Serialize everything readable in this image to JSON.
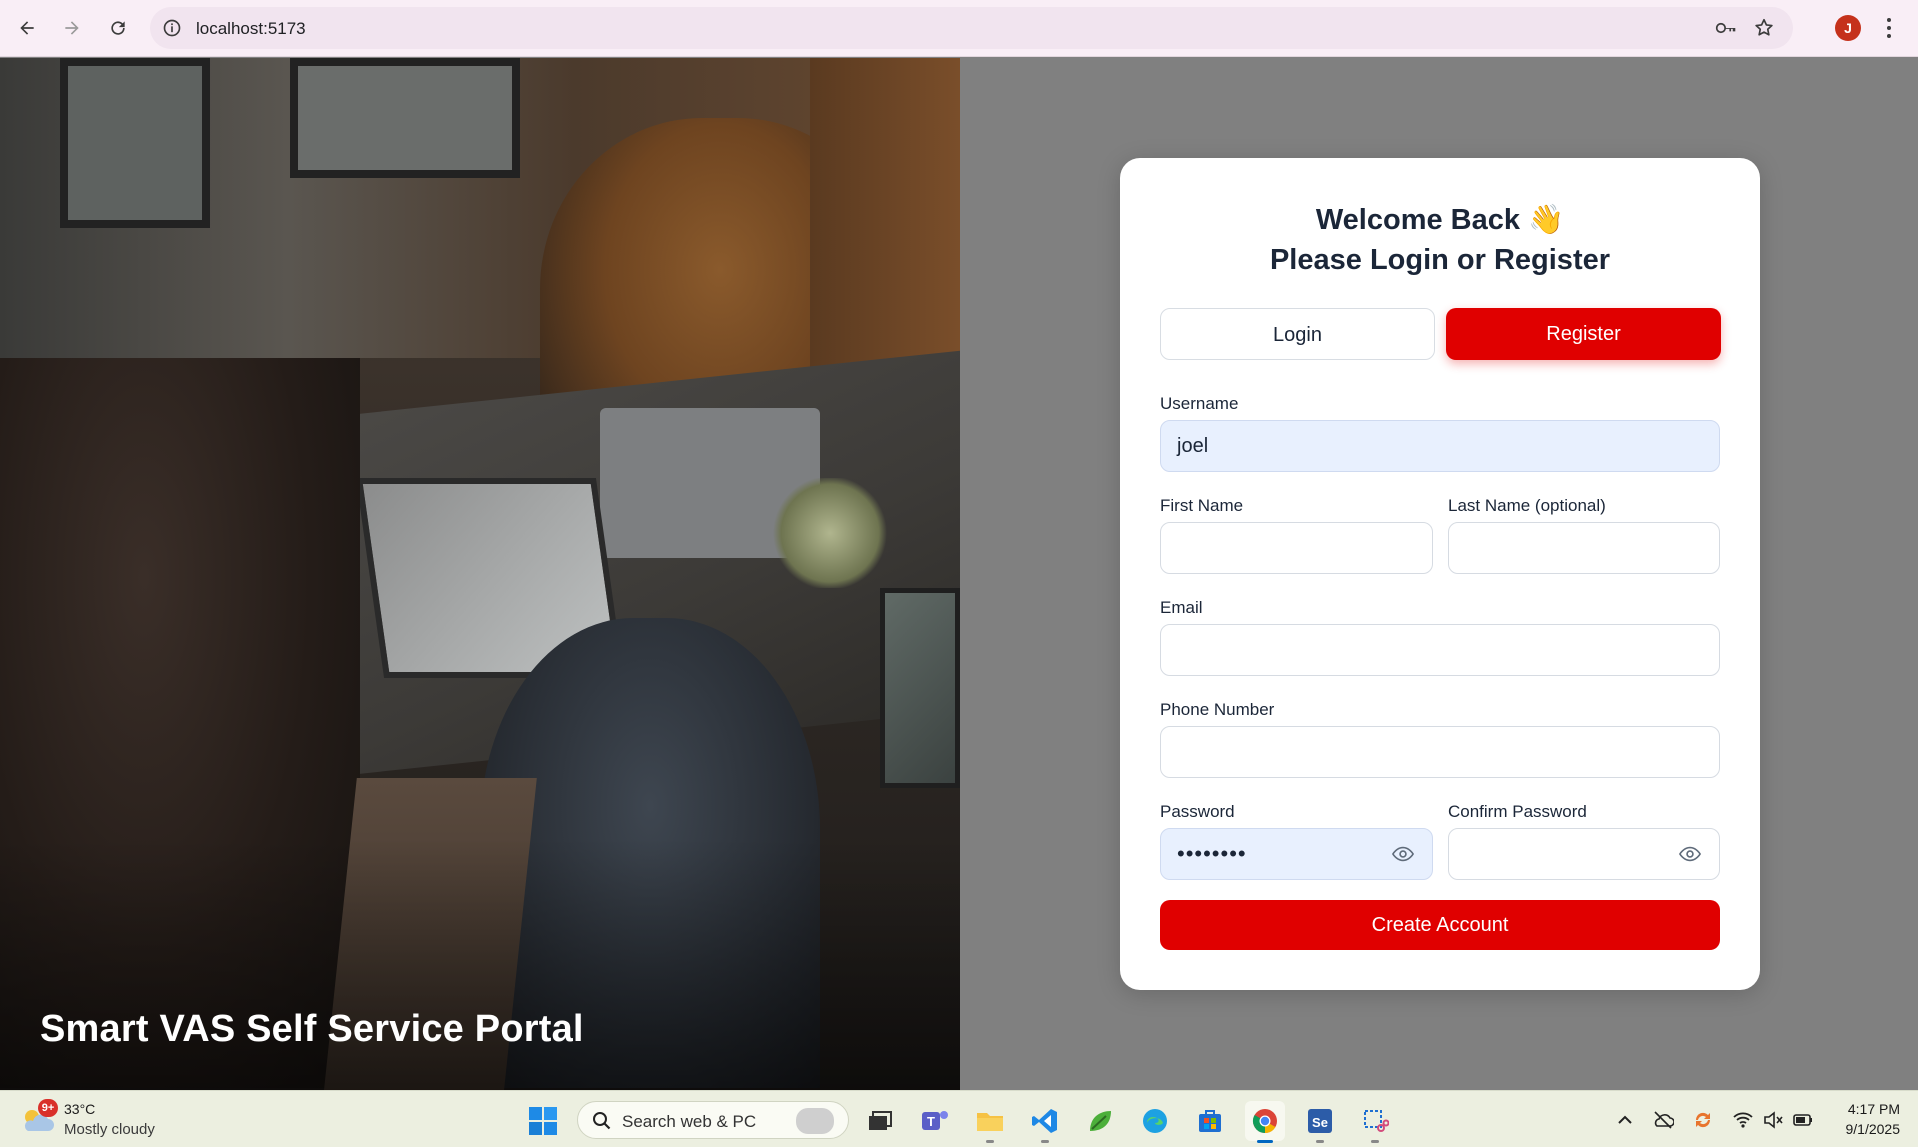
{
  "browser": {
    "url": "localhost:5173",
    "profile_initial": "J"
  },
  "hero": {
    "title": "Smart VAS Self Service Portal"
  },
  "auth": {
    "heading_line1": "Welcome Back 👋",
    "heading_line2": "Please Login or Register",
    "tabs": {
      "login": "Login",
      "register": "Register"
    },
    "active_tab": "Register",
    "fields": {
      "username": {
        "label": "Username",
        "value": "joel"
      },
      "first_name": {
        "label": "First Name",
        "value": ""
      },
      "last_name": {
        "label": "Last Name (optional)",
        "value": ""
      },
      "email": {
        "label": "Email",
        "value": ""
      },
      "phone": {
        "label": "Phone Number",
        "value": ""
      },
      "password": {
        "label": "Password",
        "value": "••••••••"
      },
      "confirm_password": {
        "label": "Confirm Password",
        "value": ""
      }
    },
    "submit_label": "Create Account",
    "accent_color": "#e00000"
  },
  "taskbar": {
    "weather_badge": "9+",
    "weather_temp": "33°C",
    "weather_desc": "Mostly cloudy",
    "search_placeholder": "Search web & PC",
    "time": "4:17 PM",
    "date": "9/1/2025",
    "apps": [
      "task-view",
      "teams",
      "file-explorer",
      "vscode",
      "app-green",
      "edge",
      "store",
      "chrome",
      "selenium",
      "snipping-tool"
    ]
  }
}
